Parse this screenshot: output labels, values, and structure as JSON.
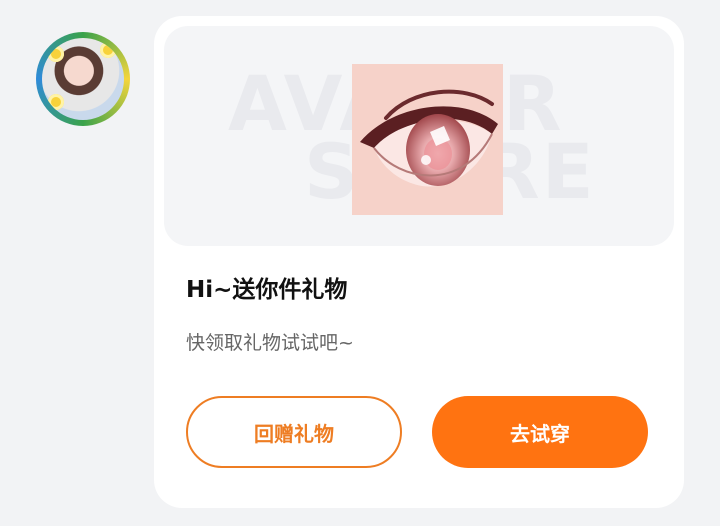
{
  "card": {
    "title": "Hi~送你件礼物",
    "subtitle": "快领取礼物试试吧~",
    "gift_item_icon": "anime-eye-icon",
    "buttons": {
      "return_gift_label": "回赠礼物",
      "try_on_label": "去试穿"
    }
  },
  "colors": {
    "accent": "#ff7311",
    "outline": "#ee7d23",
    "title": "#111111",
    "subtitle": "#666666",
    "page_bg": "#f2f3f5"
  }
}
